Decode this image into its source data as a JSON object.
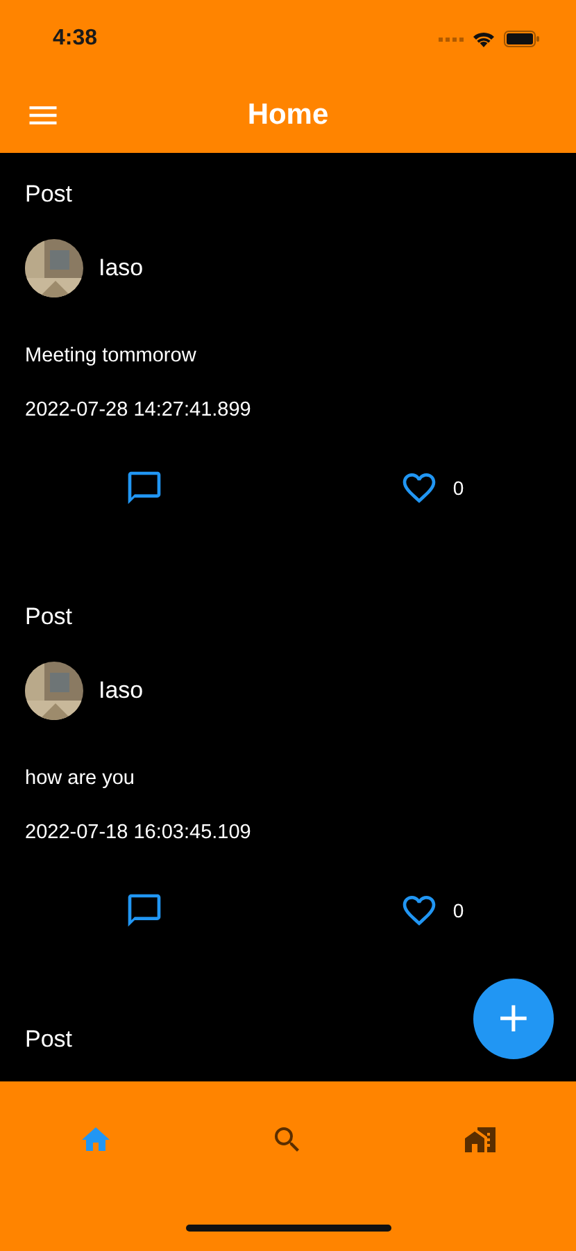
{
  "status_bar": {
    "time": "4:38"
  },
  "app_bar": {
    "title": "Home"
  },
  "posts": [
    {
      "title": "Post",
      "author": "Iaso",
      "text": "Meeting tommorow",
      "date": "2022-07-28 14:27:41.899",
      "likes": "0",
      "liked": false
    },
    {
      "title": "Post",
      "author": "Iaso",
      "text": "how are you",
      "date": "2022-07-18 16:03:45.109",
      "likes": "0",
      "liked": false
    },
    {
      "title": "Post"
    }
  ],
  "fab": {
    "label": "+"
  },
  "bottom_nav": [
    {
      "kind": "home",
      "selected": true
    },
    {
      "kind": "search",
      "selected": false
    },
    {
      "kind": "home-work",
      "selected": false
    }
  ]
}
